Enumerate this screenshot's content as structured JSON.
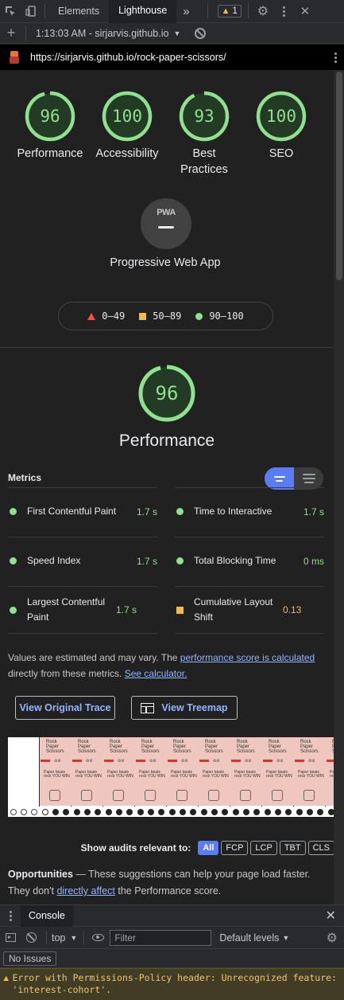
{
  "devtools": {
    "tabs": [
      "Elements",
      "Lighthouse"
    ],
    "more_tabs_glyph": "»",
    "warning_count": "1"
  },
  "lighthouse_bar": {
    "report_label": "1:13:03 AM - sirjarvis.github.io"
  },
  "url": "https://sirjarvis.github.io/rock-paper-scissors/",
  "categories": [
    {
      "score": "96",
      "label": "Performance"
    },
    {
      "score": "100",
      "label": "Accessibility"
    },
    {
      "score": "93",
      "label": "Best Practices"
    },
    {
      "score": "100",
      "label": "SEO"
    }
  ],
  "pwa": {
    "badge": "PWA",
    "label": "Progressive Web App"
  },
  "legend": [
    {
      "range": "0–49",
      "color": "#ff4e42"
    },
    {
      "range": "50–89",
      "color": "#f2b94b"
    },
    {
      "range": "90–100",
      "color": "#8fe08f"
    }
  ],
  "performance": {
    "score": "96",
    "title": "Performance",
    "metrics_heading": "Metrics",
    "metrics": [
      {
        "name": "First Contentful Paint",
        "value": "1.7 s",
        "status": "good"
      },
      {
        "name": "Time to Interactive",
        "value": "1.7 s",
        "status": "good"
      },
      {
        "name": "Speed Index",
        "value": "1.7 s",
        "status": "good"
      },
      {
        "name": "Total Blocking Time",
        "value": "0 ms",
        "status": "good"
      },
      {
        "name": "Largest Contentful Paint",
        "value": "1.7 s",
        "status": "good"
      },
      {
        "name": "Cumulative Layout Shift",
        "value": "0.13",
        "status": "average"
      }
    ],
    "note_prefix": "Values are estimated and may vary. The ",
    "note_link1": "performance score is calculated",
    "note_mid": " directly from these metrics. ",
    "note_link2": "See calculator.",
    "view_trace": "View Original Trace",
    "view_treemap": "View Treemap",
    "filmstrip": {
      "frame_title": "Rock Paper Scissors",
      "frame_text": "Paper beats rock YOU WIN"
    },
    "show_audits_label": "Show audits relevant to:",
    "audit_filters": [
      "All",
      "FCP",
      "LCP",
      "TBT",
      "CLS"
    ],
    "opportunities_title": "Opportunities",
    "opportunities_desc1": " — These suggestions can help your page load faster. They don't ",
    "opportunities_link": "directly affect",
    "opportunities_desc2": " the Performance score."
  },
  "console": {
    "tab": "Console",
    "context": "top",
    "filter_placeholder": "Filter",
    "levels": "Default levels",
    "no_issues": "No Issues",
    "warning": "Error with Permissions-Policy header: Unrecognized feature: 'interest-cohort'."
  },
  "colors": {
    "pass": "#8fe08f",
    "average": "#f2b94b",
    "fail": "#ff4e42",
    "link": "#93b4ff",
    "accent": "#5a7cf4"
  }
}
